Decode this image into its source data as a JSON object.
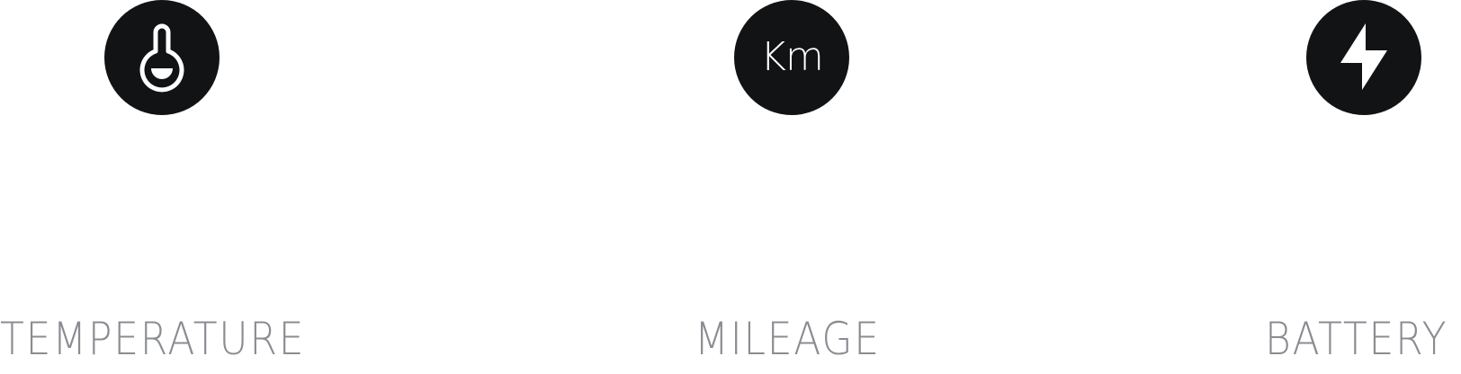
{
  "colors": {
    "icon_background": "#121314",
    "icon_foreground": "#ffffff",
    "label_text": "#8a8c91",
    "page_background": "#ffffff"
  },
  "tiles": [
    {
      "icon": "thermometer-icon",
      "label": "TEMPERATURE"
    },
    {
      "icon": "km-icon",
      "icon_text": "Km",
      "label": "MILEAGE"
    },
    {
      "icon": "lightning-bolt-icon",
      "label": "BATTERY"
    }
  ]
}
